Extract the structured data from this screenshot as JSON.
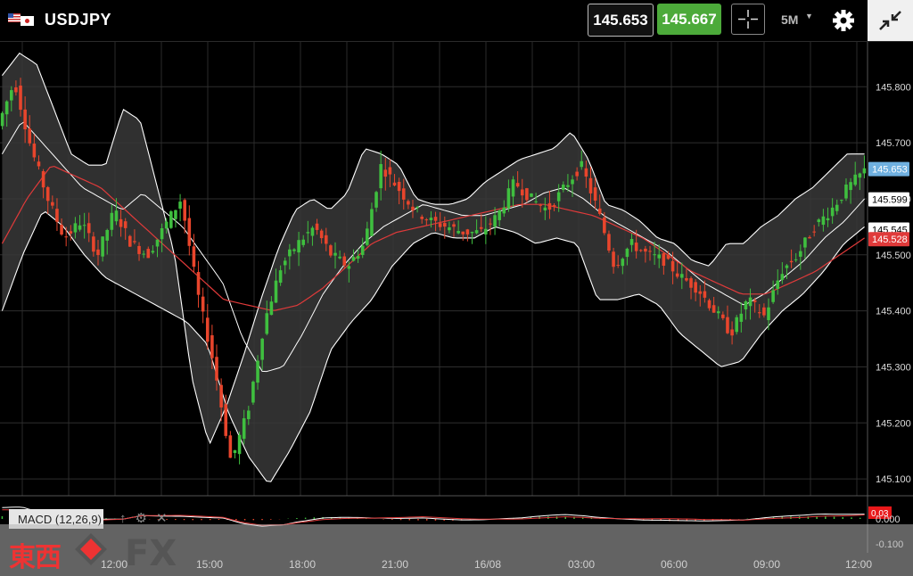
{
  "header": {
    "symbol": "USDJPY",
    "bid": "145.653",
    "ask": "145.667",
    "timeframe": "5M"
  },
  "colors": {
    "bull": "#3fbf3f",
    "bear": "#e8452c",
    "band": "#ffffff",
    "ma": "#e03a3a",
    "bid_tag": "#6fb0e0",
    "ask_button": "#4caa3a"
  },
  "macd_panel": {
    "label": "MACD (12,26,9)",
    "value_tag": "0.03",
    "ticks": [
      "0.000",
      "-0.100"
    ]
  },
  "branding": {
    "left": "東西",
    "right": "FX"
  },
  "chart_data": {
    "type": "candlestick",
    "x_ticks": [
      "12:00",
      "15:00",
      "18:00",
      "21:00",
      "16/08",
      "03:00",
      "06:00",
      "09:00",
      "12:00"
    ],
    "y_ticks": [
      "145.800",
      "145.700",
      "145.600",
      "145.500",
      "145.400",
      "145.300",
      "145.200",
      "145.100"
    ],
    "ylim": [
      145.07,
      145.88
    ],
    "price_tags": [
      {
        "value": "145.653",
        "role": "bid"
      },
      {
        "value": "145.599",
        "role": "bollinger-middle"
      },
      {
        "value": "145.545",
        "role": "bollinger-lower"
      },
      {
        "value": "145.528",
        "role": "moving-average"
      }
    ],
    "price_path": [
      145.73,
      145.81,
      145.69,
      145.6,
      145.53,
      145.56,
      145.5,
      145.58,
      145.52,
      145.5,
      145.55,
      145.6,
      145.43,
      145.3,
      145.13,
      145.22,
      145.38,
      145.48,
      145.52,
      145.55,
      145.5,
      145.48,
      145.52,
      145.66,
      145.62,
      145.58,
      145.56,
      145.55,
      145.54,
      145.54,
      145.57,
      145.63,
      145.6,
      145.58,
      145.62,
      145.66,
      145.58,
      145.48,
      145.52,
      145.5,
      145.49,
      145.46,
      145.44,
      145.4,
      145.36,
      145.42,
      145.39,
      145.47,
      145.5,
      145.55,
      145.58,
      145.62,
      145.65
    ],
    "upper_band": [
      145.82,
      145.86,
      145.84,
      145.76,
      145.68,
      145.66,
      145.66,
      145.76,
      145.74,
      145.62,
      145.5,
      145.28,
      145.16,
      145.23,
      145.32,
      145.42,
      145.51,
      145.58,
      145.6,
      145.58,
      145.61,
      145.69,
      145.68,
      145.66,
      145.6,
      145.59,
      145.59,
      145.6,
      145.63,
      145.65,
      145.67,
      145.68,
      145.69,
      145.72,
      145.67,
      145.59,
      145.58,
      145.56,
      145.53,
      145.52,
      145.49,
      145.48,
      145.52,
      145.52,
      145.55,
      145.57,
      145.6,
      145.62,
      145.65,
      145.68,
      145.68
    ],
    "middle_band": [
      145.68,
      145.74,
      145.7,
      145.66,
      145.62,
      145.6,
      145.58,
      145.61,
      145.58,
      145.55,
      145.5,
      145.45,
      145.35,
      145.29,
      145.3,
      145.36,
      145.43,
      145.48,
      145.52,
      145.55,
      145.57,
      145.59,
      145.58,
      145.57,
      145.57,
      145.58,
      145.59,
      145.61,
      145.62,
      145.6,
      145.57,
      145.55,
      145.53,
      145.51,
      145.48,
      145.45,
      145.43,
      145.41,
      145.43,
      145.46,
      145.49,
      145.53,
      145.56,
      145.6
    ],
    "lower_band": [
      145.4,
      145.5,
      145.58,
      145.55,
      145.5,
      145.46,
      145.44,
      145.42,
      145.4,
      145.38,
      145.34,
      145.22,
      145.14,
      145.09,
      145.15,
      145.22,
      145.33,
      145.38,
      145.42,
      145.48,
      145.52,
      145.54,
      145.53,
      145.53,
      145.55,
      145.54,
      145.52,
      145.53,
      145.52,
      145.42,
      145.42,
      145.43,
      145.41,
      145.36,
      145.33,
      145.3,
      145.31,
      145.36,
      145.4,
      145.43,
      145.47,
      145.52,
      145.55
    ],
    "moving_average": [
      145.52,
      145.6,
      145.66,
      145.64,
      145.62,
      145.58,
      145.54,
      145.5,
      145.46,
      145.42,
      145.41,
      145.4,
      145.41,
      145.44,
      145.48,
      145.52,
      145.54,
      145.55,
      145.56,
      145.57,
      145.58,
      145.59,
      145.59,
      145.58,
      145.57,
      145.55,
      145.53,
      145.5,
      145.47,
      145.45,
      145.43,
      145.43,
      145.45,
      145.47,
      145.5,
      145.53
    ]
  }
}
